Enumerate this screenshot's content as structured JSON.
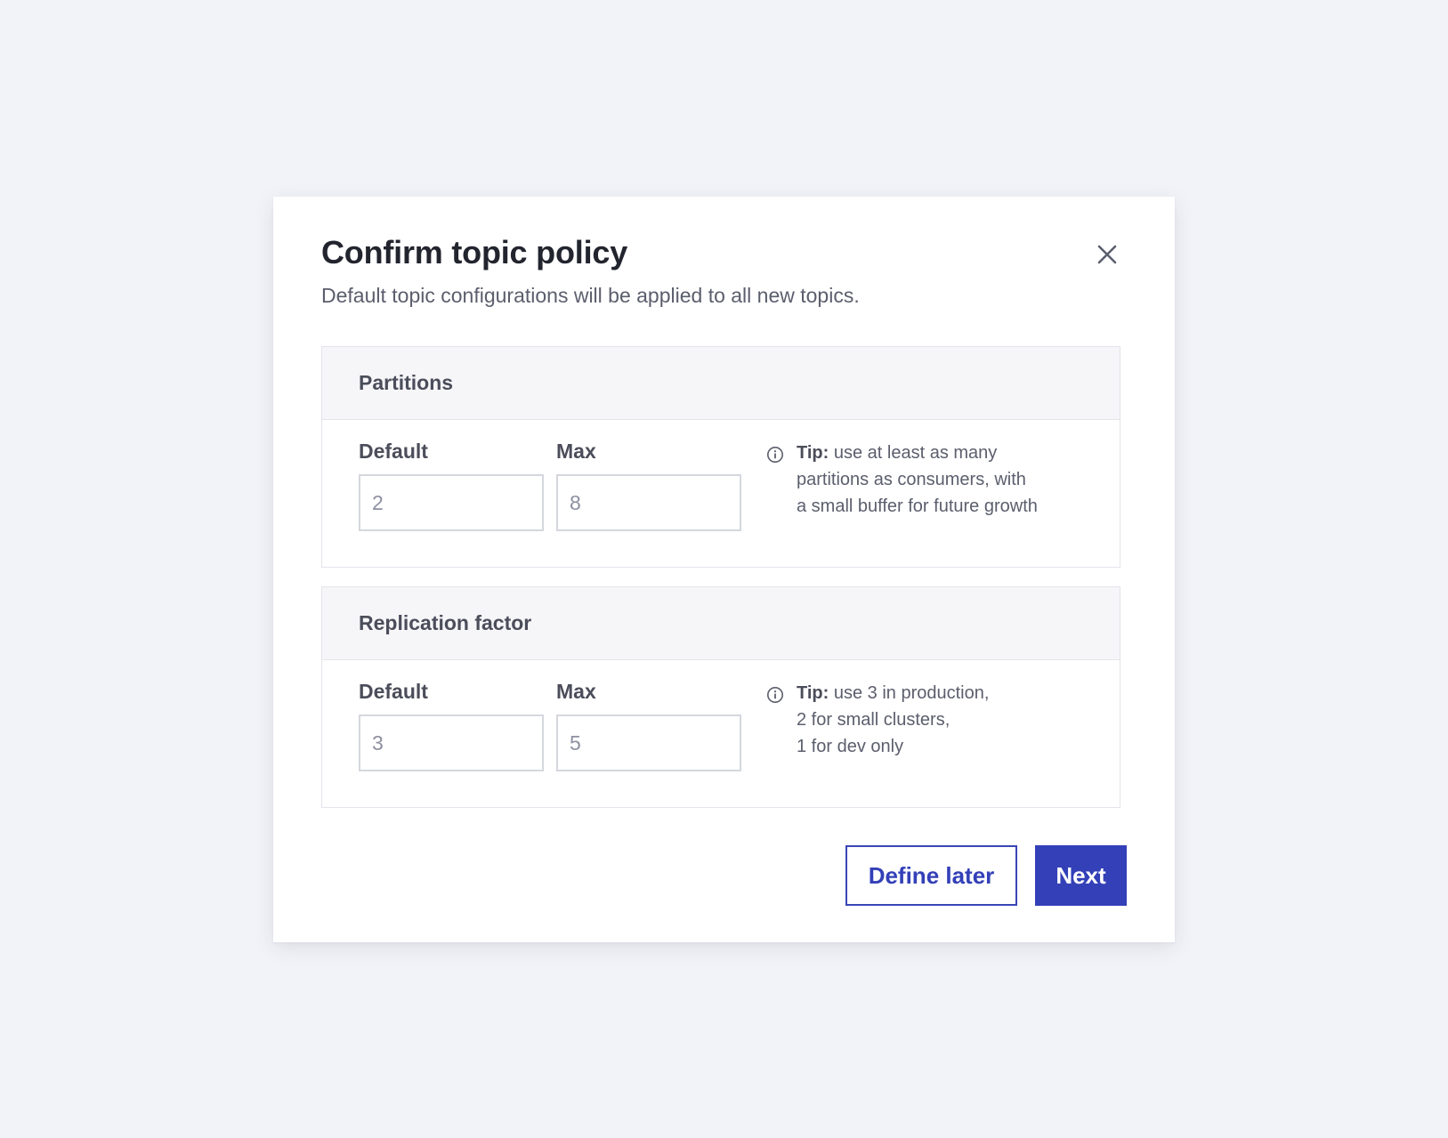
{
  "dialog": {
    "title": "Confirm topic policy",
    "subtitle": "Default topic configurations will be applied to all new topics.",
    "close_icon": "close-icon"
  },
  "sections": [
    {
      "heading": "Partitions",
      "default_label": "Default",
      "default_value": "2",
      "max_label": "Max",
      "max_value": "8",
      "tip_label": "Tip:",
      "tip_lines": [
        " use at least as many",
        "partitions as consumers, with",
        "a small buffer for future growth"
      ]
    },
    {
      "heading": "Replication factor",
      "default_label": "Default",
      "default_value": "3",
      "max_label": "Max",
      "max_value": "5",
      "tip_label": "Tip:",
      "tip_lines": [
        " use 3 in production,",
        "2 for small clusters,",
        "1 for dev only"
      ]
    }
  ],
  "actions": {
    "secondary_label": "Define later",
    "primary_label": "Next"
  },
  "colors": {
    "background": "#f2f3f8",
    "primary": "#3340b8",
    "text": "#22242e",
    "muted": "#5b5e6c"
  }
}
